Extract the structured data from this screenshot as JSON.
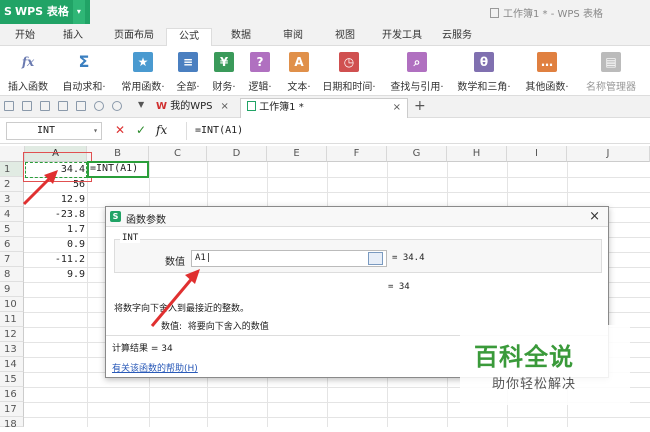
{
  "app": {
    "logo": "S",
    "name": "WPS 表格",
    "dropdown": "▾"
  },
  "window": {
    "title": "工作簿1 * - WPS 表格"
  },
  "menu_tabs": [
    "开始",
    "插入",
    "页面布局",
    "公式",
    "数据",
    "审阅",
    "视图",
    "开发工具",
    "云服务"
  ],
  "active_tab": "公式",
  "ribbon": [
    {
      "label": "插入函数",
      "icon": "fx",
      "color": "#6a7ab0"
    },
    {
      "label": "自动求和·",
      "icon": "Σ",
      "color": "#3a7fc0"
    },
    {
      "label": "常用函数·",
      "icon": "★",
      "color": "#4a9ad0"
    },
    {
      "label": "全部·",
      "icon": "≡",
      "color": "#4a7fc0"
    },
    {
      "label": "财务·",
      "icon": "¥",
      "color": "#3a9a5a"
    },
    {
      "label": "逻辑·",
      "icon": "?",
      "color": "#b070c0"
    },
    {
      "label": "文本·",
      "icon": "A",
      "color": "#e0904a"
    },
    {
      "label": "日期和时间·",
      "icon": "◷",
      "color": "#d05050"
    },
    {
      "label": "查找与引用·",
      "icon": "⌕",
      "color": "#b070c0"
    },
    {
      "label": "数学和三角·",
      "icon": "θ",
      "color": "#8070b0"
    },
    {
      "label": "其他函数·",
      "icon": "…",
      "color": "#e08040"
    },
    {
      "label": "名称管理器",
      "icon": "▤",
      "color": "#bbbbbb"
    }
  ],
  "doc_tabs": [
    {
      "label": "我的WPS",
      "close": "×"
    },
    {
      "label": "工作簿1 *",
      "close": "×"
    }
  ],
  "add_tab": "+",
  "formula_bar": {
    "name_box": "INT",
    "cancel": "✕",
    "confirm": "✓",
    "fx": "fx",
    "formula": "=INT(A1)"
  },
  "columns": [
    "A",
    "B",
    "C",
    "D",
    "E",
    "F",
    "G",
    "H",
    "I",
    "J"
  ],
  "rows": [
    "1",
    "2",
    "3",
    "4",
    "5",
    "6",
    "7",
    "8",
    "9",
    "10",
    "11",
    "12",
    "13",
    "14",
    "15",
    "16",
    "17",
    "18"
  ],
  "column_a_values": [
    "34.4",
    "56",
    "12.9",
    "-23.8",
    "1.7",
    "0.9",
    "-11.2",
    "9.9"
  ],
  "active_cell_text": "=INT(A1)",
  "dialog": {
    "title": "函数参数",
    "close": "×",
    "function_name": "INT",
    "arg_label": "数值",
    "arg_input": "A1|",
    "arg_value": "= 34.4",
    "result_preview": "= 34",
    "description": "将数字向下舍入到最接近的整数。",
    "arg_help": "数值:  将要向下舍入的数值",
    "calc_result": "计算结果 = 34",
    "help_link": "有关该函数的帮助(H)"
  },
  "watermark": {
    "main": "百科全说",
    "sub": "助你轻松解决"
  },
  "colors": {
    "accent": "#21a366",
    "selection": "#2a9e3a",
    "annotation": "#e03030"
  }
}
